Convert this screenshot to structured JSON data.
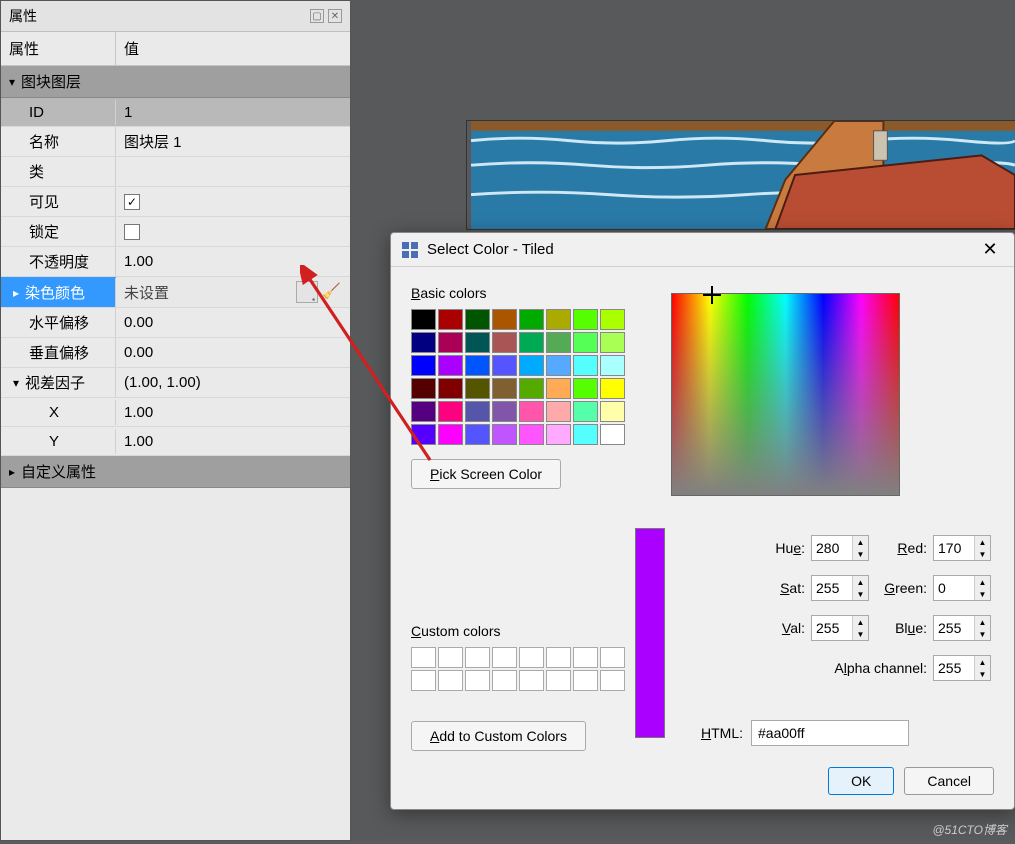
{
  "panel": {
    "title": "属性",
    "header_prop": "属性",
    "header_val": "值",
    "section": "图块图层",
    "rows": {
      "id": {
        "label": "ID",
        "value": "1"
      },
      "name": {
        "label": "名称",
        "value": "图块层 1"
      },
      "class": {
        "label": "类",
        "value": ""
      },
      "visible": {
        "label": "可见",
        "checked": true
      },
      "locked": {
        "label": "锁定",
        "checked": false
      },
      "opacity": {
        "label": "不透明度",
        "value": "1.00"
      },
      "tint": {
        "label": "染色颜色",
        "value": "未设置"
      },
      "hoffset": {
        "label": "水平偏移",
        "value": "0.00"
      },
      "voffset": {
        "label": "垂直偏移",
        "value": "0.00"
      },
      "parallax": {
        "label": "视差因子",
        "value": "(1.00, 1.00)"
      },
      "px": {
        "label": "X",
        "value": "1.00"
      },
      "py": {
        "label": "Y",
        "value": "1.00"
      }
    },
    "custom_section": "自定义属性"
  },
  "dialog": {
    "title": "Select Color - Tiled",
    "basic_label": "Basic colors",
    "pick_btn": "Pick Screen Color",
    "custom_label": "Custom colors",
    "add_custom": "Add to Custom Colors",
    "hue": {
      "label": "Hue:",
      "value": "280"
    },
    "sat": {
      "label": "Sat:",
      "value": "255"
    },
    "val": {
      "label": "Val:",
      "value": "255"
    },
    "red": {
      "label": "Red:",
      "value": "170"
    },
    "green": {
      "label": "Green:",
      "value": "0"
    },
    "blue": {
      "label": "Blue:",
      "value": "255"
    },
    "alpha": {
      "label": "Alpha channel:",
      "value": "255"
    },
    "html": {
      "label": "HTML:",
      "value": "#aa00ff"
    },
    "preview_color": "#aa00ff",
    "ok": "OK",
    "cancel": "Cancel"
  },
  "basic_colors": [
    "#000000",
    "#aa0000",
    "#005500",
    "#aa5500",
    "#00aa00",
    "#aaaa00",
    "#55ff00",
    "#aaff00",
    "#000080",
    "#aa0055",
    "#005555",
    "#aa5555",
    "#00aa55",
    "#55aa55",
    "#55ff55",
    "#aaff55",
    "#0000ff",
    "#aa00ff",
    "#0055ff",
    "#5555ff",
    "#00aaff",
    "#55aaff",
    "#55ffff",
    "#aaffff",
    "#550000",
    "#800000",
    "#555500",
    "#806030",
    "#55aa00",
    "#ffaa55",
    "#55ff00",
    "#ffff00",
    "#550080",
    "#ff0080",
    "#5555aa",
    "#8055aa",
    "#ff55aa",
    "#ffaaaa",
    "#55ffaa",
    "#ffffaa",
    "#5500ff",
    "#ff00ff",
    "#5555ff",
    "#c055ff",
    "#ff55ff",
    "#ffaaff",
    "#55ffff",
    "#ffffff"
  ],
  "watermark": "@51CTO博客"
}
